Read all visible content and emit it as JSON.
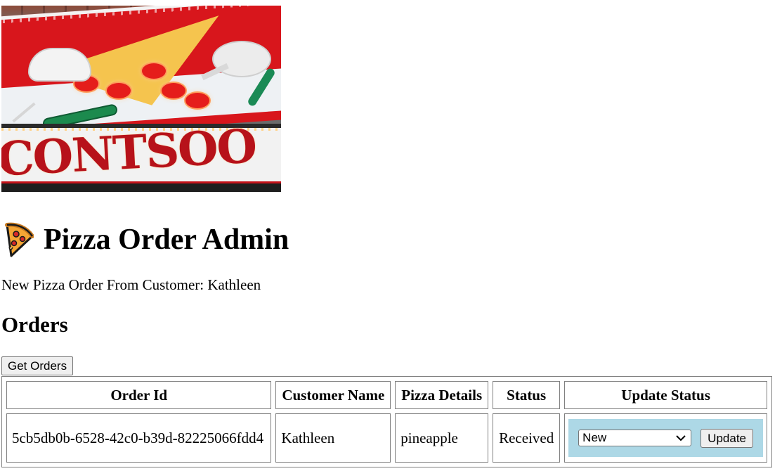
{
  "banner": {
    "alt": "Pizza restaurant sign",
    "sign_text": "CONTSOO"
  },
  "header": {
    "title": "Pizza Order Admin",
    "icon": "pizza-icon"
  },
  "notification": {
    "text": "New Pizza Order From Customer: Kathleen"
  },
  "orders": {
    "heading": "Orders",
    "get_orders_label": "Get Orders",
    "columns": [
      "Order Id",
      "Customer Name",
      "Pizza Details",
      "Status",
      "Update Status"
    ],
    "rows": [
      {
        "order_id": "5cb5db0b-6528-42c0-b39d-82225066fdd4",
        "customer_name": "Kathleen",
        "pizza_details": "pineapple",
        "status": "Received",
        "update_select_value": "New",
        "update_button_label": "Update"
      }
    ]
  },
  "colors": {
    "update_cell_bg": "#add8e6",
    "button_bg": "#efefef",
    "border": "#808080"
  }
}
